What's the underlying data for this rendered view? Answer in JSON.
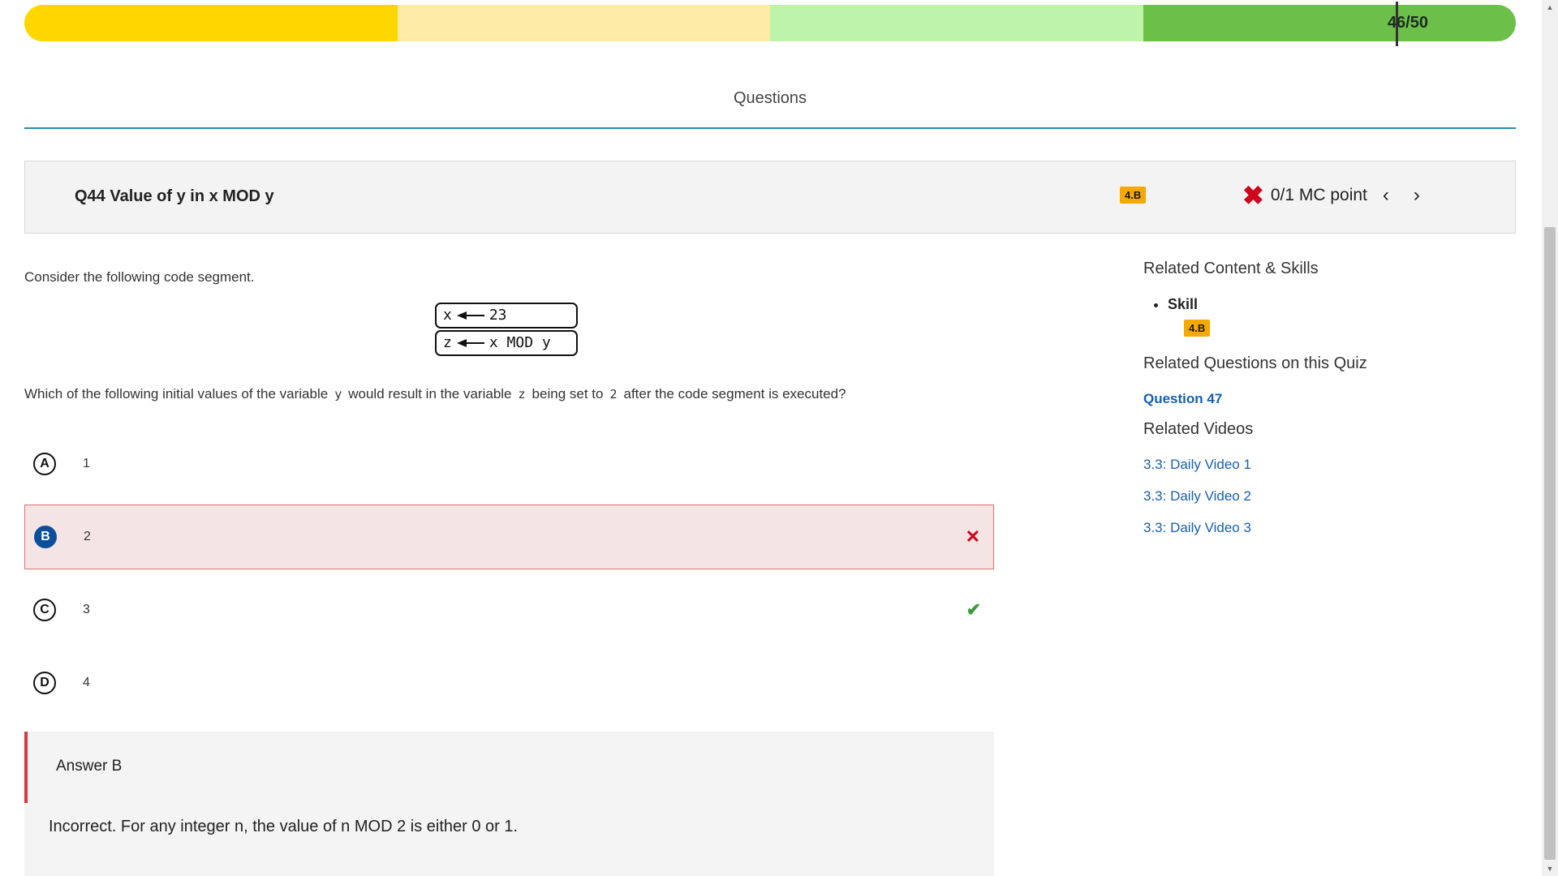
{
  "progress": {
    "label": "46/50",
    "value": 46,
    "total": 50,
    "segment_colors": [
      "#ffd700",
      "#feeba5",
      "#bdf4a9",
      "#6cc04a"
    ]
  },
  "section_title": "Questions",
  "question": {
    "title": "Q44 Value of y in x MOD y",
    "skill_badge": "4.B",
    "score": "0/1 MC point",
    "result_icon": "x-mark-icon",
    "intro": "Consider the following code segment.",
    "code": [
      {
        "var": "x",
        "expr": "23"
      },
      {
        "var": "z",
        "expr": "x MOD y"
      }
    ],
    "prompt": {
      "part1": "Which of the following initial values of the variable",
      "var_y": "y",
      "part2": "would result in the variable",
      "var_z": "z",
      "part3": "being set to",
      "val_2": "2",
      "part4": "after the code segment is executed?"
    },
    "choices": [
      {
        "letter": "A",
        "value": "1"
      },
      {
        "letter": "B",
        "value": "2",
        "selected": true,
        "mark": "✕"
      },
      {
        "letter": "C",
        "value": "3",
        "mark": "✔"
      },
      {
        "letter": "D",
        "value": "4"
      }
    ]
  },
  "answer": {
    "label": "Answer B",
    "explanation": "Incorrect. For any integer n, the value of n MOD 2 is either 0 or 1."
  },
  "sidebar": {
    "related_content_title": "Related Content & Skills",
    "skill_label": "Skill",
    "skill_badge": "4.B",
    "related_questions_title": "Related Questions on this Quiz",
    "related_questions": [
      "Question 47"
    ],
    "related_videos_title": "Related Videos",
    "videos": [
      "3.3: Daily Video 1",
      "3.3: Daily Video 2",
      "3.3: Daily Video 3"
    ]
  }
}
